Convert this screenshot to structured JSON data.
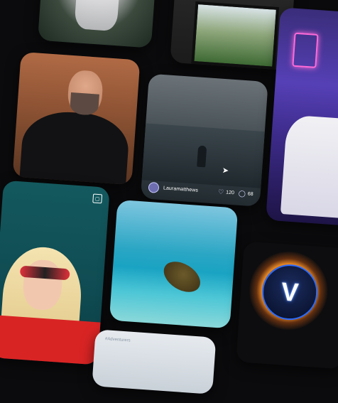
{
  "feed": {
    "hand_post": {
      "username": "Lauramatthews",
      "likes": "120",
      "comments": "68"
    },
    "bottom_post": {
      "caption": "#Adventurers"
    },
    "logo": {
      "letter": "V",
      "accent": "#2a6bff",
      "glow": "#ff9628"
    },
    "icons": {
      "like": "heart-icon",
      "comment": "comment-icon",
      "save": "bookmark-icon",
      "cursor": "cursor-icon"
    }
  }
}
